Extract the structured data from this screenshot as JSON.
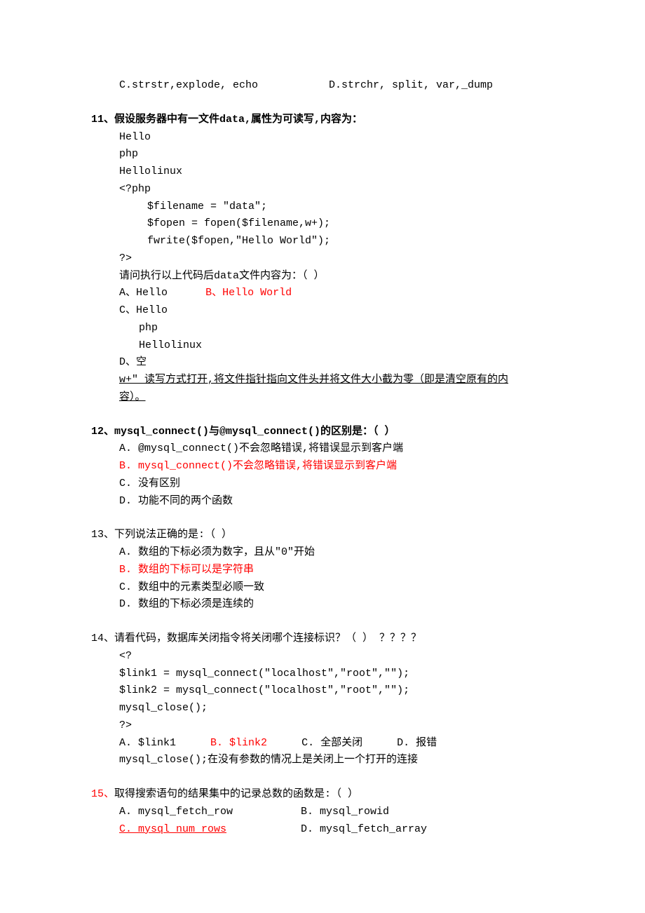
{
  "q10_tail": {
    "optC": "C.strstr,explode, echo",
    "optD": "D.strchr, split, var,_dump"
  },
  "q11": {
    "title": "11、假设服务器中有一文件data,属性为可读写,内容为：",
    "l1": "Hello",
    "l2": "php",
    "l3": "Hellolinux",
    "l4": "<?php",
    "l5": "$filename = \"data\";",
    "l6": "$fopen = fopen($filename,w+);",
    "l7": "fwrite($fopen,\"Hello World\");",
    "l8": "?>",
    "prompt": "请问执行以上代码后data文件内容为：（  ）",
    "optA": "A、Hello",
    "optB": "B、Hello World",
    "optC": "C、Hello",
    "optC_l2": "php",
    "optC_l3": "Hellolinux",
    "optD": "D、空",
    "explain1": "w+\" 读写方式打开,将文件指针指向文件头并将文件大小截为零（即是清空原有的内",
    "explain2": "容）。"
  },
  "q12": {
    "title": "12、mysql_connect()与@mysql_connect()的区别是：（  ）",
    "optA": "A. @mysql_connect()不会忽略错误,将错误显示到客户端",
    "optB": "B. mysql_connect()不会忽略错误,将错误显示到客户端",
    "optC": "C. 没有区别",
    "optD": "D. 功能不同的两个函数"
  },
  "q13": {
    "title": "13、下列说法正确的是:（  ）",
    "optA": "A. 数组的下标必须为数字，且从\"0\"开始",
    "optB": "B. 数组的下标可以是字符串",
    "optC": "C. 数组中的元素类型必顺一致",
    "optD": "D. 数组的下标必须是连续的"
  },
  "q14": {
    "title": "14、请看代码，数据库关闭指令将关闭哪个连接标识？（  ） ？？？？",
    "l1": "<?",
    "l2": "$link1 = mysql_connect(\"localhost\",\"root\",\"\");",
    "l3": "$link2 = mysql_connect(\"localhost\",\"root\",\"\");",
    "l4": "mysql_close();",
    "l5": "?>",
    "optA": "A. $link1",
    "optB": "B. $link2",
    "optC": "C. 全部关闭",
    "optD": "D. 报错",
    "explain": "mysql_close();在没有参数的情况上是关闭上一个打开的连接"
  },
  "q15": {
    "title_prefix": "15、",
    "title_rest": "取得搜索语句的结果集中的记录总数的函数是:（  ）",
    "optA": "A. mysql_fetch_row",
    "optB": "B. mysql_rowid",
    "optC": "C. mysql_num_rows",
    "optD": "D. mysql_fetch_array"
  }
}
